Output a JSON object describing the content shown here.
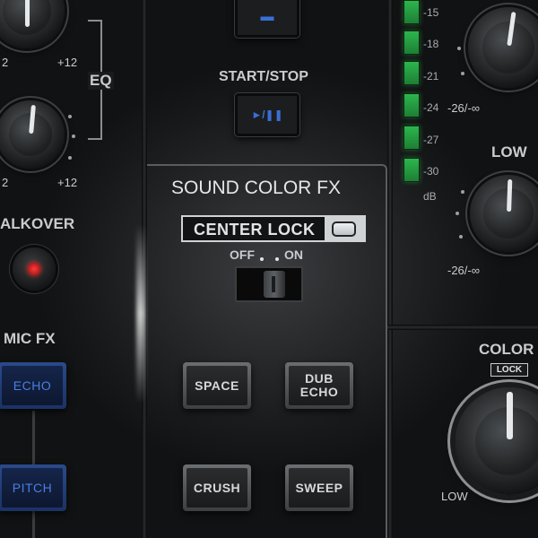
{
  "left_strip": {
    "eq_label": "EQ",
    "eq_scale_min": "2",
    "eq_scale_max": "+12",
    "eq_scale_min2": "2",
    "eq_scale_max2": "+12",
    "talkover_label": "ALKOVER",
    "mic_fx_label": "MIC FX",
    "mic_fx_buttons": [
      {
        "label": "ECHO"
      },
      {
        "label": "PITCH"
      }
    ]
  },
  "center": {
    "start_stop_label": "START/STOP",
    "play_pause_glyph": "►/❚❚",
    "top_button_glyph": "▬",
    "section_title": "SOUND COLOR FX",
    "center_lock_label": "CENTER LOCK",
    "toggle_off_label": "OFF",
    "toggle_on_label": "ON",
    "fx_buttons": [
      {
        "label": "SPACE"
      },
      {
        "label": "DUB\nECHO"
      },
      {
        "label": "CRUSH"
      },
      {
        "label": "SWEEP"
      }
    ]
  },
  "meter": {
    "db_labels": [
      "-15",
      "-18",
      "-21",
      "-24",
      "-27",
      "-30",
      "dB"
    ],
    "color_hex": "#2cb64c"
  },
  "right": {
    "hi_scale_min": "-26/-∞",
    "low_label": "LOW",
    "low_scale_min": "-26/-∞",
    "color_label": "COLOR",
    "lock_tag": "LOCK",
    "color_low_label": "LOW"
  },
  "icons": {
    "record_led": "red-led-icon",
    "center_lock_led": "led-indicator-icon"
  }
}
